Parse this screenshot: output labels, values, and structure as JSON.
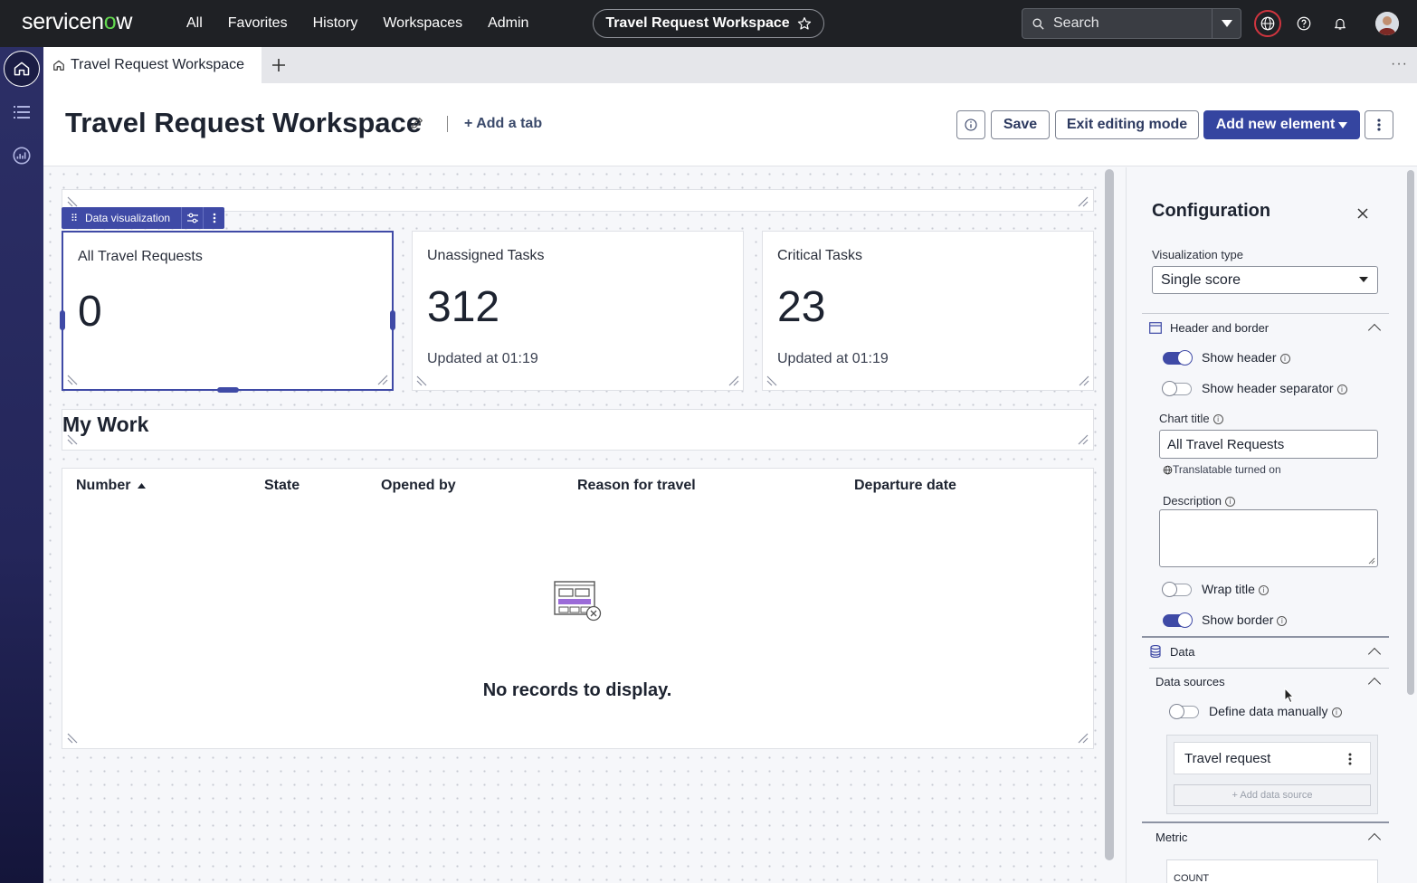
{
  "topnav": {
    "logo": "servicenow",
    "menu": [
      "All",
      "Favorites",
      "History",
      "Workspaces",
      "Admin"
    ],
    "workspace_pill": "Travel Request Workspace",
    "search_placeholder": "Search"
  },
  "tabs": {
    "active_tab": "Travel Request Workspace"
  },
  "header": {
    "title": "Travel Request Workspace",
    "add_tab": "Add a tab",
    "save": "Save",
    "exit_editing": "Exit editing mode",
    "add_new_element": "Add new element"
  },
  "toolbar": {
    "label": "Data visualization"
  },
  "cards": [
    {
      "title": "All Travel Requests",
      "value": "0",
      "updated": ""
    },
    {
      "title": "Unassigned Tasks",
      "value": "312",
      "updated": "Updated at 01:19"
    },
    {
      "title": "Critical Tasks",
      "value": "23",
      "updated": "Updated at 01:19"
    }
  ],
  "my_work": {
    "heading": "My Work",
    "columns": [
      "Number",
      "State",
      "Opened by",
      "Reason for travel",
      "Departure date"
    ],
    "empty_message": "No records to display."
  },
  "config": {
    "title": "Configuration",
    "viz_type_label": "Visualization type",
    "viz_type_value": "Single score",
    "header_border_section": "Header and border",
    "show_header": "Show header",
    "show_header_separator": "Show header separator",
    "chart_title_label": "Chart title",
    "chart_title_value": "All Travel Requests",
    "translatable": "Translatable turned on",
    "description_label": "Description",
    "wrap_title": "Wrap title",
    "show_border": "Show border",
    "data_section": "Data",
    "data_sources_section": "Data sources",
    "define_manually": "Define data manually",
    "data_source_item": "Travel request",
    "add_data_source": "+ Add data source",
    "metric_section": "Metric",
    "metric_value": "COUNT"
  },
  "colors": {
    "accent": "#3f4aa6",
    "topnav_bg": "#1f2125",
    "brand_green": "#62d84e"
  }
}
